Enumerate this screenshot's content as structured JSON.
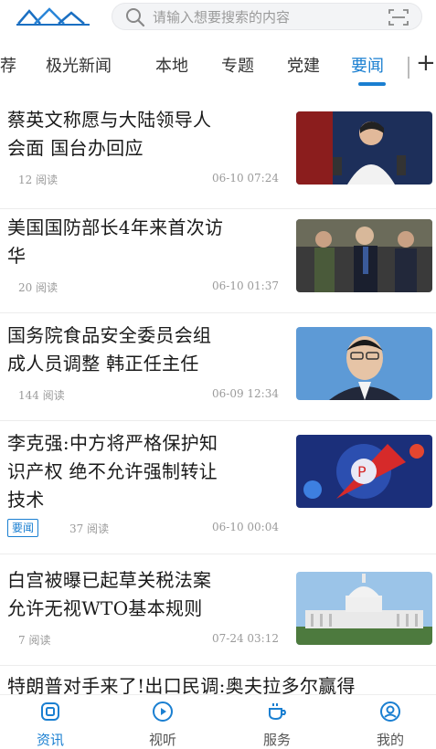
{
  "search": {
    "placeholder": "请输入想要搜索的内容"
  },
  "tabs": [
    {
      "label": "荐"
    },
    {
      "label": "极光新闻"
    },
    {
      "label": "本地"
    },
    {
      "label": "专题"
    },
    {
      "label": "党建"
    },
    {
      "label": "要闻",
      "active": true
    }
  ],
  "articles": [
    {
      "title_lines": [
        "蔡英文称愿与大陆领导人",
        "会面 国台办回应"
      ],
      "reads": "12 阅读",
      "time": "06-10 07:24"
    },
    {
      "title_lines": [
        "美国国防部长4年来首次访",
        "华"
      ],
      "reads": "20 阅读",
      "time": "06-10 01:37"
    },
    {
      "title_lines": [
        "国务院食品安全委员会组",
        "成人员调整 韩正任主任"
      ],
      "reads": "144 阅读",
      "time": "06-09 12:34"
    },
    {
      "title_lines": [
        "李克强:中方将严格保护知",
        "识产权 绝不允许强制转让",
        "技术"
      ],
      "badge": "要闻",
      "reads": "37 阅读",
      "time": "06-10 00:04"
    },
    {
      "title_lines": [
        "白宫被曝已起草关税法案",
        "允许无视WTO基本规则"
      ],
      "reads": "7 阅读",
      "time": "07-24 03:12"
    },
    {
      "title_lines": [
        "特朗普对手来了!出口民调:奥夫拉多尔赢得"
      ]
    }
  ],
  "bottom_nav": [
    {
      "label": "资讯",
      "icon": "news-icon",
      "active": true
    },
    {
      "label": "视听",
      "icon": "play-icon"
    },
    {
      "label": "服务",
      "icon": "coffee-icon"
    },
    {
      "label": "我的",
      "icon": "profile-icon"
    }
  ],
  "colors": {
    "accent": "#1a7fd1"
  }
}
